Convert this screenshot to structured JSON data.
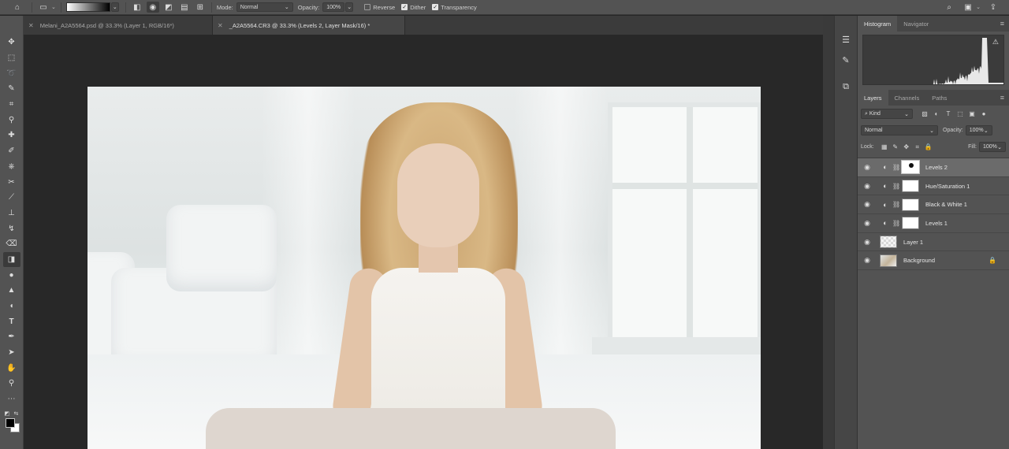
{
  "options_bar": {
    "mode_label": "Mode:",
    "mode_value": "Normal",
    "opacity_label": "Opacity:",
    "opacity_value": "100%",
    "reverse_label": "Reverse",
    "reverse_checked": false,
    "dither_label": "Dither",
    "dither_checked": true,
    "transparency_label": "Transparency",
    "transparency_checked": true
  },
  "tabs": [
    {
      "label": "Melani_A2A5564.psd @ 33.3% (Layer 1, RGB/16*)",
      "active": false
    },
    {
      "label": "_A2A5564.CR3 @ 33.3% (Levels 2, Layer Mask/16) *",
      "active": true
    }
  ],
  "top_panel": {
    "tabs": [
      "Histogram",
      "Navigator"
    ],
    "active_tab": "Histogram"
  },
  "layers_panel": {
    "tabs": [
      "Layers",
      "Channels",
      "Paths"
    ],
    "active_tab": "Layers",
    "filter_value": "Kind",
    "blend_mode": "Normal",
    "opacity_label": "Opacity:",
    "opacity_value": "100%",
    "lock_label": "Lock:",
    "fill_label": "Fill:",
    "fill_value": "100%",
    "layers": [
      {
        "name": "Levels 2",
        "type": "adjustment",
        "selected": true
      },
      {
        "name": "Hue/Saturation 1",
        "type": "adjustment",
        "selected": false
      },
      {
        "name": "Black & White 1",
        "type": "adjustment",
        "selected": false
      },
      {
        "name": "Levels 1",
        "type": "adjustment",
        "selected": false
      },
      {
        "name": "Layer 1",
        "type": "pixel",
        "selected": false
      },
      {
        "name": "Background",
        "type": "background",
        "selected": false,
        "locked": true
      }
    ]
  },
  "colors": {
    "foreground": "#000000",
    "background": "#ffffff"
  }
}
